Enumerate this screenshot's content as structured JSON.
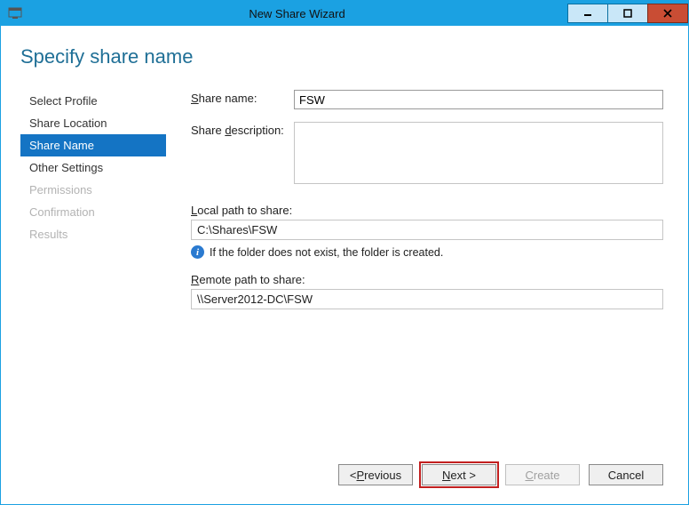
{
  "window": {
    "title": "New Share Wizard"
  },
  "page": {
    "heading": "Specify share name"
  },
  "nav": {
    "items": [
      {
        "label": "Select Profile",
        "state": "normal"
      },
      {
        "label": "Share Location",
        "state": "normal"
      },
      {
        "label": "Share Name",
        "state": "selected"
      },
      {
        "label": "Other Settings",
        "state": "normal"
      },
      {
        "label": "Permissions",
        "state": "disabled"
      },
      {
        "label": "Confirmation",
        "state": "disabled"
      },
      {
        "label": "Results",
        "state": "disabled"
      }
    ]
  },
  "form": {
    "share_name_label": "Share name:",
    "share_name_accesskey": "S",
    "share_name_value": "FSW",
    "share_desc_label": "Share description:",
    "share_desc_accesskey": "d",
    "share_desc_value": "",
    "local_path_label": "Local path to share:",
    "local_path_accesskey": "L",
    "local_path_value": "C:\\Shares\\FSW",
    "info_text": "If the folder does not exist, the folder is created.",
    "remote_path_label": "Remote path to share:",
    "remote_path_accesskey": "R",
    "remote_path_value": "\\\\Server2012-DC\\FSW"
  },
  "buttons": {
    "previous": "< Previous",
    "previous_accesskey": "P",
    "next": "Next >",
    "next_accesskey": "N",
    "create": "Create",
    "create_accesskey": "C",
    "cancel": "Cancel"
  }
}
